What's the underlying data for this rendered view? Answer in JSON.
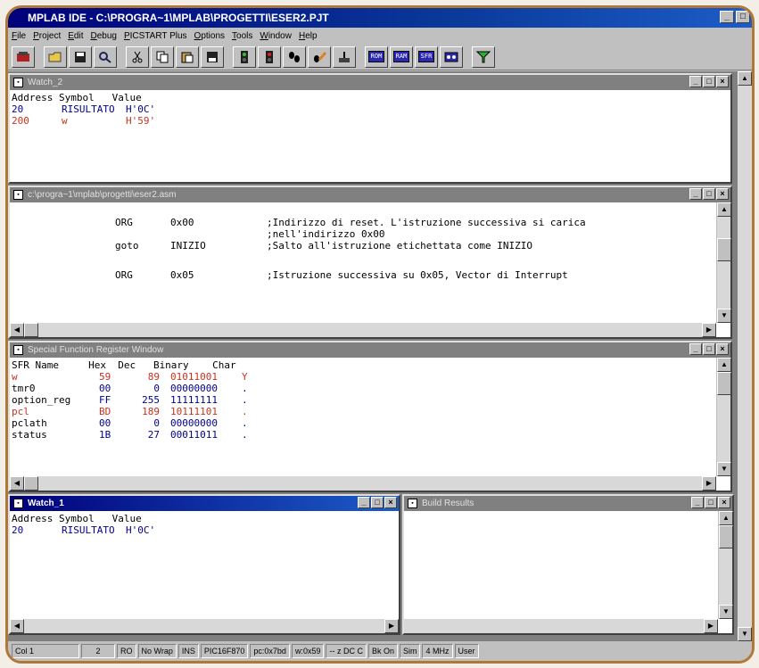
{
  "app": {
    "title": "MPLAB IDE - C:\\PROGRA~1\\MPLAB\\PROGETTI\\ESER2.PJT",
    "minimize": "_"
  },
  "menu": [
    "File",
    "Project",
    "Edit",
    "Debug",
    "PICSTART Plus",
    "Options",
    "Tools",
    "Window",
    "Help"
  ],
  "toolbar": {
    "rom": "ROM",
    "ram": "RAM",
    "sfr": "SFR"
  },
  "watch2": {
    "title": "Watch_2",
    "header": "Address Symbol   Value",
    "rows": [
      {
        "addr": "20",
        "sym": "RISULTATO",
        "val": "H'0C'"
      },
      {
        "addr": "200",
        "sym": "w",
        "val": "H'59'"
      }
    ]
  },
  "editor": {
    "title": "c:\\progra~1\\mplab\\progetti\\eser2.asm",
    "lines": [
      {
        "op": "ORG",
        "arg": "0x00",
        "cmt": ";Indirizzo di reset. L'istruzione successiva si carica"
      },
      {
        "op": "",
        "arg": "",
        "cmt": ";nell'indirizzo 0x00"
      },
      {
        "op": "goto",
        "arg": "INIZIO",
        "cmt": ";Salto all'istruzione etichettata come INIZIO"
      },
      {
        "op": "",
        "arg": "",
        "cmt": ""
      },
      {
        "op": "ORG",
        "arg": "0x05",
        "cmt": ";Istruzione successiva su 0x05, Vector di Interrupt"
      }
    ]
  },
  "sfr": {
    "title": "Special Function Register Window",
    "header": "SFR Name     Hex  Dec   Binary    Char",
    "rows": [
      {
        "name": "w",
        "hex": "59",
        "dec": "89",
        "bin": "01011001",
        "chr": "Y",
        "changed": true
      },
      {
        "name": "tmr0",
        "hex": "00",
        "dec": "0",
        "bin": "00000000",
        "chr": ".",
        "changed": false
      },
      {
        "name": "option_reg",
        "hex": "FF",
        "dec": "255",
        "bin": "11111111",
        "chr": ".",
        "changed": false
      },
      {
        "name": "pcl",
        "hex": "BD",
        "dec": "189",
        "bin": "10111101",
        "chr": ".",
        "changed": true
      },
      {
        "name": "pclath",
        "hex": "00",
        "dec": "0",
        "bin": "00000000",
        "chr": ".",
        "changed": false
      },
      {
        "name": "status",
        "hex": "1B",
        "dec": "27",
        "bin": "00011011",
        "chr": ".",
        "changed": false
      }
    ]
  },
  "watch1": {
    "title": "Watch_1",
    "header": "Address Symbol   Value",
    "rows": [
      {
        "addr": "20",
        "sym": "RISULTATO",
        "val": "H'0C'"
      }
    ]
  },
  "build": {
    "title": "Build Results"
  },
  "status": [
    "Col 1",
    "2",
    "RO",
    "No Wrap",
    "INS",
    "PIC16F870",
    "pc:0x7bd",
    "w:0x59",
    "-- z DC C",
    "Bk On",
    "Sim",
    "4 MHz",
    "User"
  ],
  "colors": {
    "title_active": "#00007a",
    "changed_value": "#c8321e",
    "value": "#00008b"
  }
}
